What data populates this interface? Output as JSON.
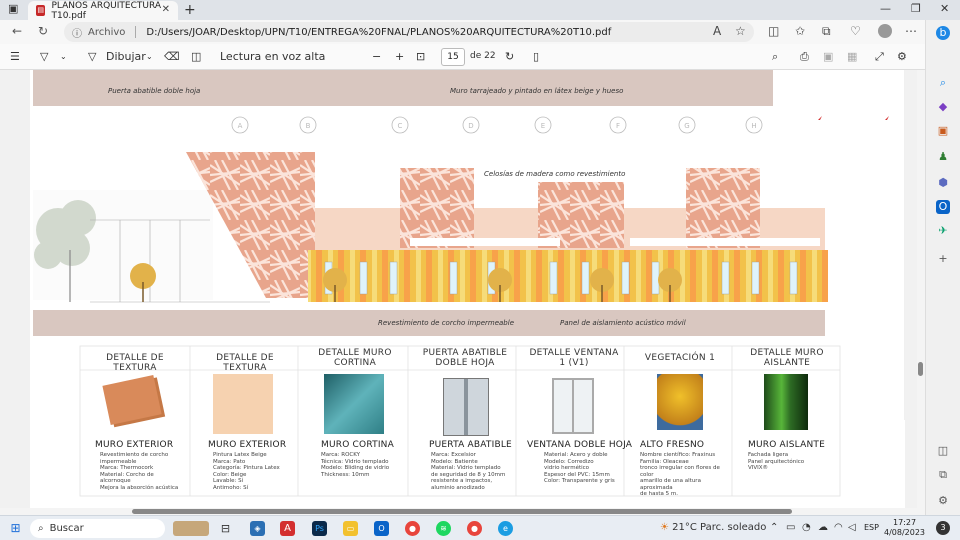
{
  "browser": {
    "tab_title": "PLANOS ARQUITECTURA T10.pdf",
    "tab_close": "✕",
    "new_tab": "+",
    "address_prefix": "Archivo",
    "url": "D:/Users/JOAR/Desktop/UPN/T10/ENTREGA%20FNAL/PLANOS%20ARQUITECTURA%20T10.pdf"
  },
  "pdf_toolbar": {
    "draw_label": "Dibujar",
    "read_aloud_label": "Lectura en voz alta",
    "page_current": "15",
    "page_total": "de 22"
  },
  "drawing": {
    "top_left_label": "Puerta abatible doble hoja",
    "top_right_label": "Muro tarrajeado y pintado en látex beige y hueso",
    "lattice_label": "Celosías de madera como revestimiento",
    "bottom_left_label": "Revestimiento de corcho impermeable",
    "bottom_right_label": "Panel de aislamiento acústico móvil",
    "axis_markers": [
      "A",
      "B",
      "C",
      "D",
      "E",
      "F",
      "G",
      "H"
    ]
  },
  "details": [
    {
      "title": "DETALLE DE TEXTURA",
      "subtitle": "MURO EXTERIOR",
      "color": "#d98a5a",
      "lines": [
        "Revestimiento de corcho",
        "impermeable",
        "Marca: Thermocork",
        "Material: Corcho de",
        "alcornoque",
        "Mejora la absorción acústica"
      ]
    },
    {
      "title": "DETALLE DE TEXTURA",
      "subtitle": "MURO EXTERIOR",
      "color": "#f6d2b0",
      "lines": [
        "Pintura Latex Beige",
        "Marca: Pato",
        "Categoría: Pintura Latex",
        "Color: Beige",
        "Lavable: Sí",
        "Antimoho: Sí"
      ]
    },
    {
      "title": "DETALLE MURO CORTINA",
      "subtitle": "MURO CORTINA",
      "color": "#2f7f86",
      "lines": [
        "Marca: ROCKY",
        "Técnica: Vidrio templado",
        "Modelo: Bliding de vidrio",
        "Thickness: 10mm"
      ]
    },
    {
      "title": "PUERTA ABATIBLE DOBLE HOJA",
      "subtitle": "PUERTA ABATIBLE",
      "color": "#9aa3ad",
      "lines": [
        "Marca: Excelsior",
        "Modelo: Batiente",
        "Material: Vidrio templado",
        "de seguridad de 8 y 10mm",
        "resistente a impactos,",
        "aluminio anodizado"
      ]
    },
    {
      "title": "DETALLE VENTANA 1 (V1)",
      "subtitle": "VENTANA DOBLE HOJA",
      "color": "#e6e6e6",
      "lines": [
        "Material: Acero y doble",
        "Modelo: Corredizo",
        "vidrio hermético",
        "Espesor del PVC: 15mm",
        "Color: Transparente y gris"
      ]
    },
    {
      "title": "VEGETACIÓN 1",
      "subtitle": "ALTO FRESNO",
      "color": "#e0a21e",
      "lines": [
        "Nombre científico: Fraxinus",
        "Familia: Oleaceae",
        "tronco irregular con flores de color",
        "amarillo de una altura aproximada",
        "de hasta 5 m."
      ]
    },
    {
      "title": "DETALLE MURO AISLANTE",
      "subtitle": "MURO AISLANTE",
      "color": "#3c8a2c",
      "lines": [
        "Fachada ligera",
        "Panel arquitectónico",
        "VIVIX®"
      ]
    }
  ],
  "taskbar": {
    "search_label": "Buscar",
    "weather": "21°C  Parc. soleado",
    "language": "ESP",
    "time": "17:27",
    "date": "4/08/2023",
    "notifications": "3"
  }
}
